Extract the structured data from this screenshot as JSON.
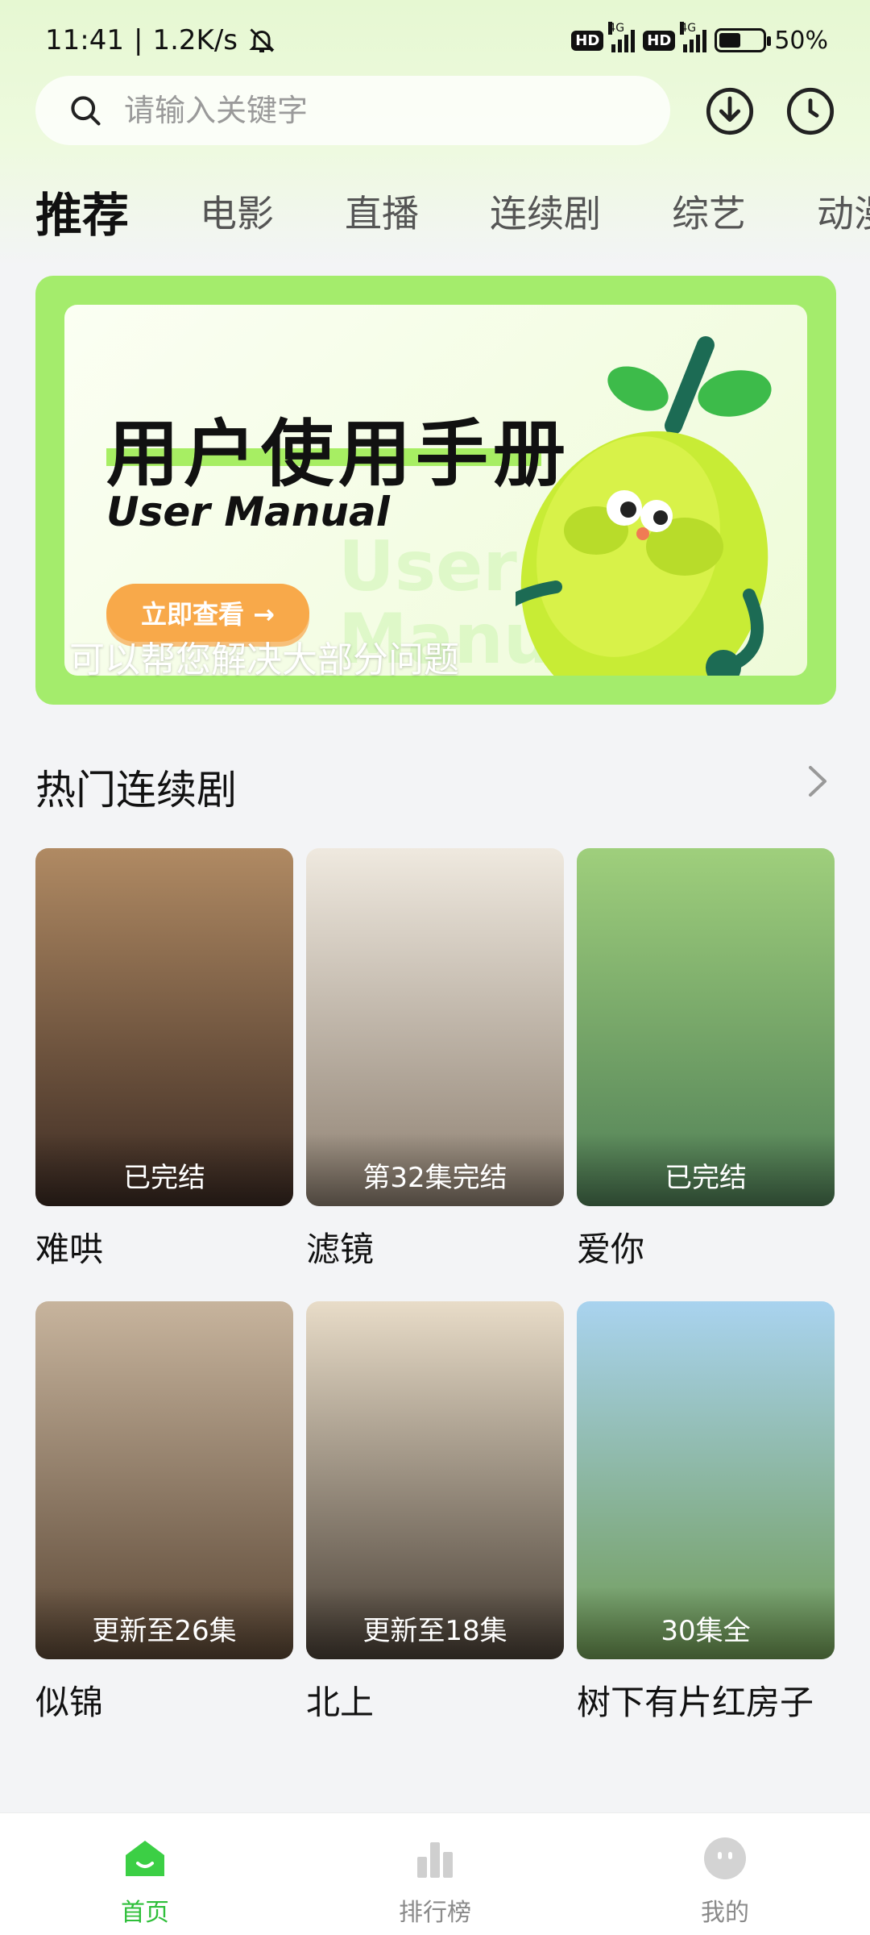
{
  "status_bar": {
    "time": "11:41",
    "separator": "|",
    "speed": "1.2K/s",
    "hd1": "HD",
    "net1": "4G",
    "hd2": "HD",
    "net2": "4G",
    "battery": "50%"
  },
  "search": {
    "placeholder": "请输入关键字"
  },
  "tabs": [
    {
      "label": "推荐",
      "active": true
    },
    {
      "label": "电影"
    },
    {
      "label": "直播"
    },
    {
      "label": "连续剧"
    },
    {
      "label": "综艺"
    },
    {
      "label": "动漫"
    }
  ],
  "banner": {
    "title": "用户使用手册",
    "subtitle": "User Manual",
    "watermark_line1": "User",
    "watermark_line2": "Manual",
    "button_label": "立即查看 →",
    "caption": "可以帮您解决大部分问题"
  },
  "section": {
    "title": "热门连续剧"
  },
  "dramas": [
    {
      "title": "难哄",
      "badge": "已完结",
      "color_top": "#b08a63",
      "color_bottom": "#3b2a22"
    },
    {
      "title": "滤镜",
      "badge": "第32集完结",
      "color_top": "#efe9df",
      "color_bottom": "#8d7f70"
    },
    {
      "title": "爱你",
      "badge": "已完结",
      "color_top": "#9fcf7c",
      "color_bottom": "#4f7e56"
    },
    {
      "title": "似锦",
      "badge": "更新至26集",
      "color_top": "#c7b49d",
      "color_bottom": "#5a4634"
    },
    {
      "title": "北上",
      "badge": "更新至18集",
      "color_top": "#e8dcc8",
      "color_bottom": "#4a4036"
    },
    {
      "title": "树下有片红房子",
      "badge": "30集全",
      "color_top": "#a9d3ef",
      "color_bottom": "#6f9a54"
    }
  ],
  "nav": [
    {
      "label": "首页",
      "icon": "home-icon",
      "active": true
    },
    {
      "label": "排行榜",
      "icon": "chart-bar-icon"
    },
    {
      "label": "我的",
      "icon": "profile-icon"
    }
  ],
  "colors": {
    "accent": "#2fbf3a",
    "banner_green": "#a4ec6c",
    "banner_button": "#f8a94a"
  }
}
